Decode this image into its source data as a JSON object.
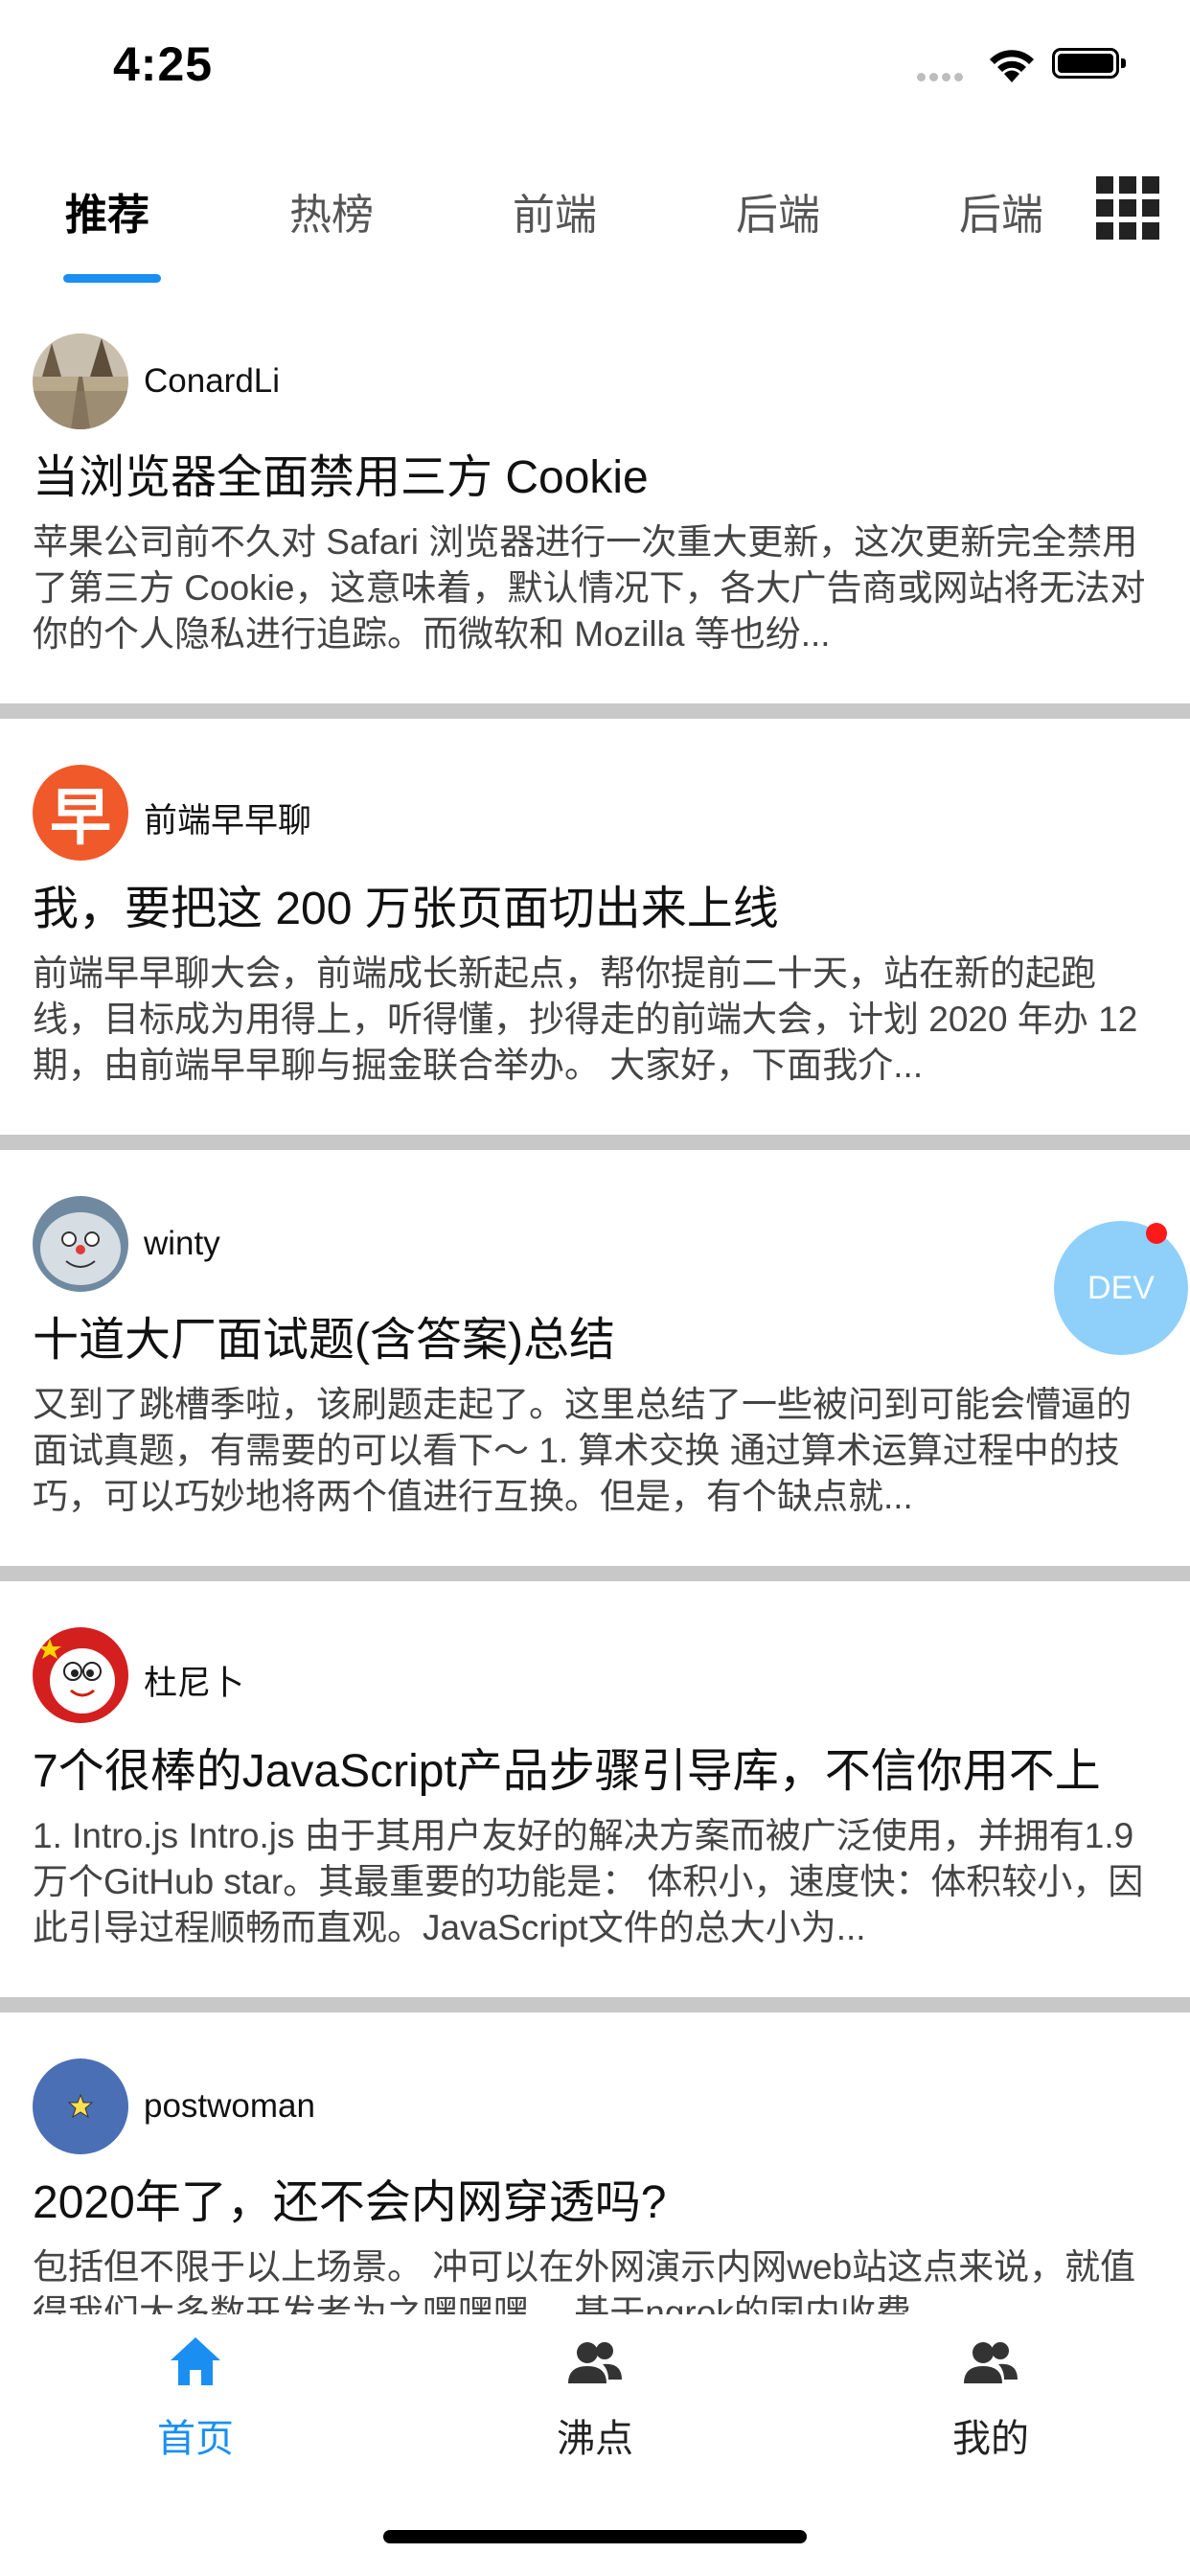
{
  "status_bar": {
    "time": "4:25"
  },
  "tabs": [
    {
      "label": "推荐",
      "active": true
    },
    {
      "label": "热榜"
    },
    {
      "label": "前端"
    },
    {
      "label": "后端"
    },
    {
      "label": "后端"
    }
  ],
  "articles": [
    {
      "author": "ConardLi",
      "title": "当浏览器全面禁用三方 Cookie",
      "summary": "苹果公司前不久对 Safari 浏览器进行一次重大更新，这次更新完全禁用了第三方 Cookie，这意味着，默认情况下，各大广告商或网站将无法对你的个人隐私进行追踪。而微软和 Mozilla 等也纷..."
    },
    {
      "author": "前端早早聊",
      "avatar_char": "早",
      "title": "我，要把这 200 万张页面切出来上线",
      "summary": "前端早早聊大会，前端成长新起点，帮你提前二十天，站在新的起跑线，目标成为用得上，听得懂，抄得走的前端大会，计划 2020 年办 12 期，由前端早早聊与掘金联合举办。 大家好，下面我介..."
    },
    {
      "author": "winty",
      "title": "十道大厂面试题(含答案)总结",
      "summary": "又到了跳槽季啦，该刷题走起了。这里总结了一些被问到可能会懵逼的面试真题，有需要的可以看下～ 1. 算术交换 通过算术运算过程中的技巧，可以巧妙地将两个值进行互换。但是，有个缺点就..."
    },
    {
      "author": "杜尼卜",
      "title": "7个很棒的JavaScript产品步骤引导库，不信你用不上",
      "summary": "1. Intro.js Intro.js 由于其用户友好的解决方案而被广泛使用，并拥有1.9万个GitHub star。其最重要的功能是： 体积小，速度快：体积较小，因此引导过程顺畅而直观。JavaScript文件的总大小为..."
    },
    {
      "author": "postwoman",
      "title": "2020年了，还不会内网穿透吗?",
      "summary": "包括但不限于以上场景。 冲可以在外网演示内网web站这点来说，就值得我们大多数开发者为之嘿嘿嘿。 基于ngrok的国内收费"
    }
  ],
  "floating_button": {
    "label": "DEV",
    "has_badge": true
  },
  "bottom_nav": [
    {
      "label": "首页",
      "icon": "home-icon",
      "active": true
    },
    {
      "label": "沸点",
      "icon": "users-icon"
    },
    {
      "label": "我的",
      "icon": "users-icon"
    }
  ],
  "colors": {
    "accent": "#1a8ff1",
    "divider": "#c8c8c8",
    "dev_button": "#8fd0fa",
    "badge": "#ff1a1a"
  }
}
